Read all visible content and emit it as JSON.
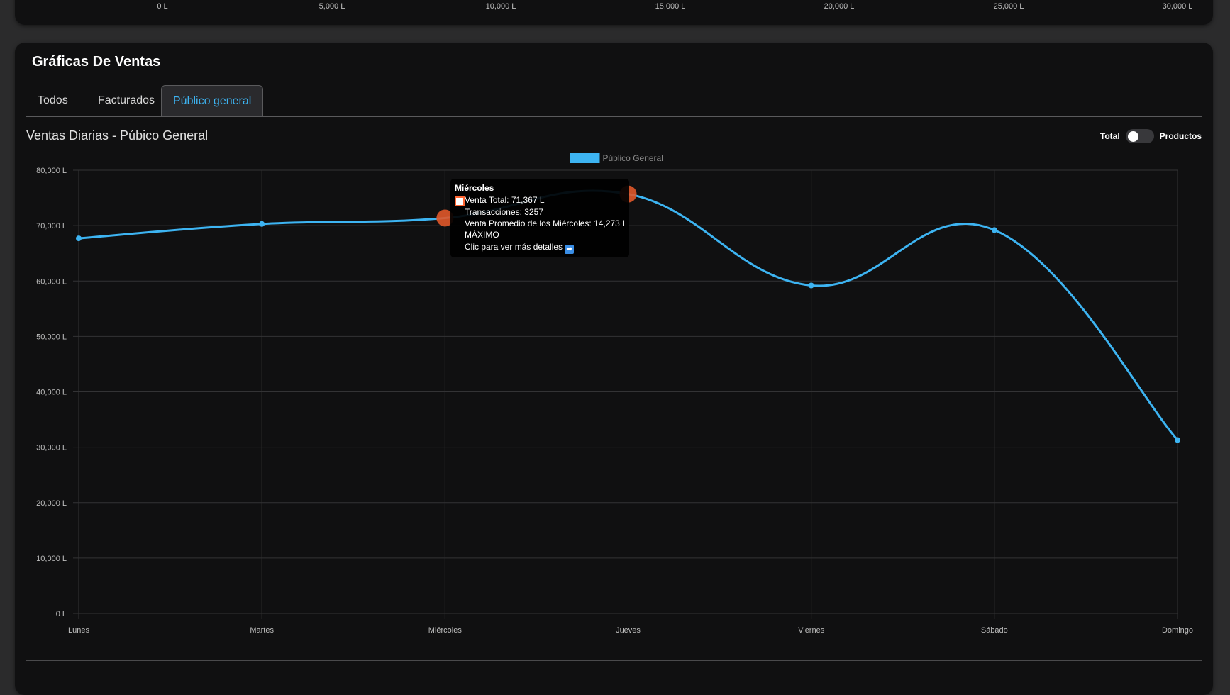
{
  "top_axis": {
    "ticks": [
      "0 L",
      "5,000 L",
      "10,000 L",
      "15,000 L",
      "20,000 L",
      "25,000 L",
      "30,000 L"
    ]
  },
  "card": {
    "title": "Gráficas De Ventas"
  },
  "tabs": [
    {
      "label": "Todos",
      "active": false
    },
    {
      "label": "Facturados",
      "active": false
    },
    {
      "label": "Público general",
      "active": true
    }
  ],
  "toggle": {
    "left_label": "Total",
    "right_label": "Productos",
    "state": "off"
  },
  "tooltip": {
    "title": "Miércoles",
    "line1": "Venta Total: 71,367 L",
    "line2": "Transacciones: 3257",
    "line3": "Venta Promedio de los Miércoles: 14,273 L",
    "line4": "MÁXIMO",
    "line5": "Clic para ver más detalles",
    "arrow_icon": "➡"
  },
  "colors": {
    "series": "#3db4f2",
    "highlight": "#e0582a",
    "active_tab": "#3db4f2"
  },
  "chart_data": {
    "type": "line",
    "title": "Ventas Diarias - Púbico General",
    "categories": [
      "Lunes",
      "Martes",
      "Miércoles",
      "Jueves",
      "Viernes",
      "Sábado",
      "Domingo"
    ],
    "series": [
      {
        "name": "Público General",
        "values": [
          67700,
          70300,
          71367,
          75700,
          59200,
          69200,
          31300
        ]
      }
    ],
    "highlighted_points": [
      "Miércoles",
      "Jueves"
    ],
    "ylim": [
      0,
      80000
    ],
    "y_ticks": [
      "0 L",
      "10,000 L",
      "20,000 L",
      "30,000 L",
      "40,000 L",
      "50,000 L",
      "60,000 L",
      "70,000 L",
      "80,000 L"
    ],
    "xlabel": "",
    "ylabel": "",
    "grid": true,
    "legend": "top-center"
  }
}
